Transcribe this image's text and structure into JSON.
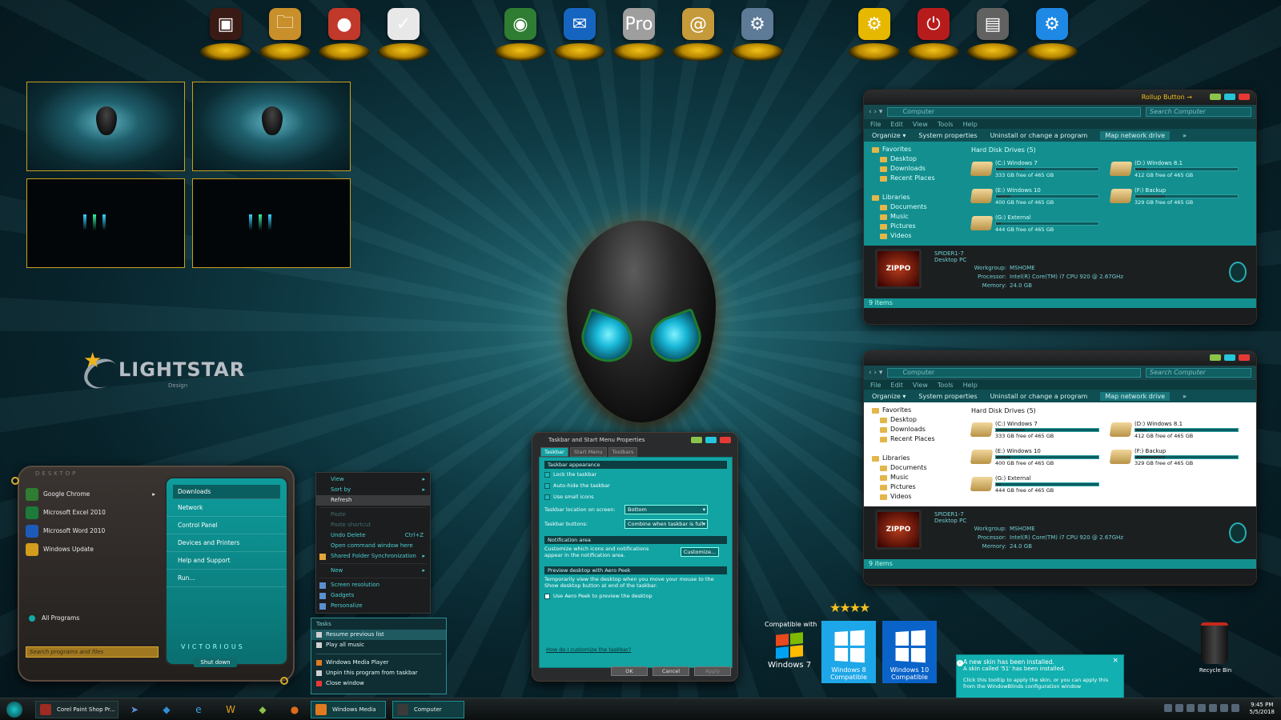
{
  "dock": {
    "left": [
      {
        "name": "zippo-icon",
        "color": "#3a1a14",
        "glyph": "▣"
      },
      {
        "name": "folder-icon",
        "color": "#c98f2a",
        "glyph": "🗀"
      },
      {
        "name": "zippo-ball-icon",
        "color": "#c0392b",
        "glyph": "●"
      },
      {
        "name": "calendar-check-icon",
        "color": "#e8e8e8",
        "glyph": "✓"
      }
    ],
    "middle": [
      {
        "name": "chrome-icon",
        "color": "#2e7d32",
        "glyph": "◉"
      },
      {
        "name": "thunderbird-icon",
        "color": "#1565c0",
        "glyph": "✉"
      },
      {
        "name": "pro-ball-icon",
        "color": "#9e9e9e",
        "glyph": "Pro"
      },
      {
        "name": "address-book-icon",
        "color": "#c49a3a",
        "glyph": "@"
      },
      {
        "name": "control-panel-icon",
        "color": "#5d7a96",
        "glyph": "⚙"
      }
    ],
    "right": [
      {
        "name": "settings-folder-icon",
        "color": "#e6b800",
        "glyph": "⚙"
      },
      {
        "name": "power-gear-icon",
        "color": "#b71c1c",
        "glyph": "⏻"
      },
      {
        "name": "server-icon",
        "color": "#616161",
        "glyph": "▤"
      },
      {
        "name": "gear-molecule-icon",
        "color": "#1e88e5",
        "glyph": "⚙"
      }
    ]
  },
  "lightstar": {
    "word": "LIGHTSTAR",
    "sub": "Design"
  },
  "explorer1": {
    "rollup": "Rollup Button →",
    "path": "Computer",
    "search": "Search Computer",
    "menu": [
      "File",
      "Edit",
      "View",
      "Tools",
      "Help"
    ],
    "cmd": {
      "organize": "Organize ▾",
      "system": "System properties",
      "uninstall": "Uninstall or change a program",
      "map": "Map network drive",
      "more": "»"
    },
    "nav": [
      {
        "label": "Favorites",
        "child": false
      },
      {
        "label": "Desktop",
        "child": true
      },
      {
        "label": "Downloads",
        "child": true
      },
      {
        "label": "Recent Places",
        "child": true
      },
      {
        "label": "",
        "child": false
      },
      {
        "label": "Libraries",
        "child": false
      },
      {
        "label": "Documents",
        "child": true
      },
      {
        "label": "Music",
        "child": true
      },
      {
        "label": "Pictures",
        "child": true
      },
      {
        "label": "Videos",
        "child": true
      }
    ],
    "group": "Hard Disk Drives (5)",
    "drives": [
      {
        "name": "(C:) Windows 7",
        "free": "333 GB free of 465 GB",
        "used": 0.28
      },
      {
        "name": "(D:) Windows 8.1",
        "free": "412 GB free of 465 GB",
        "used": 0.11
      },
      {
        "name": "(E:) Windows 10",
        "free": "400 GB free of 465 GB",
        "used": 0.14
      },
      {
        "name": "(F:) Backup",
        "free": "329 GB free of 465 GB",
        "used": 0.29
      },
      {
        "name": "(G:) External",
        "free": "444 GB free of 465 GB",
        "used": 0.05
      }
    ],
    "details": {
      "pc_label": "ZIPPO",
      "name": "SPIDER1-7",
      "type": "Desktop PC",
      "rows": [
        {
          "k": "Workgroup:",
          "v": "MSHOME"
        },
        {
          "k": "Processor:",
          "v": "Intel(R) Core(TM) i7 CPU       920  @ 2.67GHz"
        },
        {
          "k": "Memory:",
          "v": "24.0 GB"
        }
      ]
    },
    "status": "9 items"
  },
  "explorer2": {
    "path": "Computer",
    "search": "Search Computer",
    "menu": [
      "File",
      "Edit",
      "View",
      "Tools",
      "Help"
    ],
    "cmd": {
      "organize": "Organize ▾",
      "system": "System properties",
      "uninstall": "Uninstall or change a program",
      "map": "Map network drive",
      "more": "»"
    },
    "nav": [
      {
        "label": "Favorites",
        "child": false
      },
      {
        "label": "Desktop",
        "child": true
      },
      {
        "label": "Downloads",
        "child": true
      },
      {
        "label": "Recent Places",
        "child": true
      },
      {
        "label": "",
        "child": false
      },
      {
        "label": "Libraries",
        "child": false
      },
      {
        "label": "Documents",
        "child": true
      },
      {
        "label": "Music",
        "child": true
      },
      {
        "label": "Pictures",
        "child": true
      },
      {
        "label": "Videos",
        "child": true
      }
    ],
    "group": "Hard Disk Drives (5)",
    "drives": [
      {
        "name": "(C:) Windows 7",
        "free": "333 GB free of 465 GB",
        "used": 0.28
      },
      {
        "name": "(D:) Windows 8.1",
        "free": "412 GB free of 465 GB",
        "used": 0.11
      },
      {
        "name": "(E:) Windows 10",
        "free": "400 GB free of 465 GB",
        "used": 0.14
      },
      {
        "name": "(F:) Backup",
        "free": "329 GB free of 465 GB",
        "used": 0.29
      },
      {
        "name": "(G:) External",
        "free": "444 GB free of 465 GB",
        "used": 0.05
      }
    ],
    "details": {
      "pc_label": "ZIPPO",
      "name": "SPIDER1-7",
      "type": "Desktop PC",
      "rows": [
        {
          "k": "Workgroup:",
          "v": "MSHOME"
        },
        {
          "k": "Processor:",
          "v": "Intel(R) Core(TM) i7 CPU       920  @ 2.67GHz"
        },
        {
          "k": "Memory:",
          "v": "24.0 GB"
        }
      ]
    },
    "status": "9 items"
  },
  "start": {
    "topbar": "DESKTOP",
    "apps": [
      {
        "label": "Google Chrome",
        "color": "#2e7d32",
        "arrow": "▸"
      },
      {
        "label": "Microsoft Excel 2010",
        "color": "#1d7a3a",
        "arrow": ""
      },
      {
        "label": "Microsoft Word 2010",
        "color": "#1e5bb8",
        "arrow": ""
      },
      {
        "label": "Windows Update",
        "color": "#d39c1d",
        "arrow": ""
      }
    ],
    "all_programs": "All Programs",
    "search": "Search programs and files",
    "right": [
      "Downloads",
      "Network",
      "Control Panel",
      "Devices and Printers",
      "Help and Support",
      "Run..."
    ],
    "signature": "VICTORIOUS",
    "shutdown": "Shut down"
  },
  "context_menu": [
    {
      "label": "View",
      "arrow": "▸",
      "state": ""
    },
    {
      "label": "Sort by",
      "arrow": "▸",
      "state": ""
    },
    {
      "label": "Refresh",
      "arrow": "",
      "state": "hl"
    },
    {
      "sep": true
    },
    {
      "label": "Paste",
      "arrow": "",
      "state": "dis"
    },
    {
      "label": "Paste shortcut",
      "arrow": "",
      "state": "dis"
    },
    {
      "label": "Undo Delete",
      "shortcut": "Ctrl+Z",
      "state": ""
    },
    {
      "label": "Open command window here",
      "state": ""
    },
    {
      "label": "Shared Folder Synchronization",
      "arrow": "▸",
      "state": "",
      "icon": "#e3a53a"
    },
    {
      "sep": true
    },
    {
      "label": "New",
      "arrow": "▸",
      "state": ""
    },
    {
      "sep": true
    },
    {
      "label": "Screen resolution",
      "state": "",
      "icon": "#5a8fd0"
    },
    {
      "label": "Gadgets",
      "state": "",
      "icon": "#5a8fd0"
    },
    {
      "label": "Personalize",
      "state": "",
      "icon": "#5a8fd0"
    }
  ],
  "jumplist": {
    "header": "Tasks",
    "tasks": [
      "Resume previous list",
      "Play all music"
    ],
    "pinned": [
      "Windows Media Player",
      "Unpin this program from taskbar",
      "Close window"
    ]
  },
  "props": {
    "title": "Taskbar and Start Menu Properties",
    "tabs": [
      "Taskbar",
      "Start Menu",
      "Toolbars"
    ],
    "appearance": "Taskbar appearance",
    "checks": [
      {
        "label": "Lock the taskbar",
        "on": false
      },
      {
        "label": "Auto-hide the taskbar",
        "on": false
      },
      {
        "label": "Use small icons",
        "on": false
      }
    ],
    "location_label": "Taskbar location on screen:",
    "location_value": "Bottom",
    "buttons_label": "Taskbar buttons:",
    "buttons_value": "Combine when taskbar is full",
    "notif": "Notification area",
    "notif_text": "Customize which icons and notifications appear in the notification area.",
    "customize": "Customize...",
    "peek": "Preview desktop with Aero Peek",
    "peek_text": "Temporarily view the desktop when you move your mouse to the Show desktop button at end of the taskbar.",
    "peek_check": "Use Aero Peek to preview the desktop",
    "howto": "How do I customize the taskbar?",
    "ok": "OK",
    "cancel": "Cancel",
    "apply": "Apply"
  },
  "compat": {
    "label": "Compatible with",
    "win7": "Windows 7",
    "win8": {
      "name": "Windows 8",
      "comp": "Compatible",
      "bg": "#1ea7e8"
    },
    "win10": {
      "name": "Windows 10",
      "comp": "Compatible",
      "bg": "#0a63c9"
    },
    "stars": "★★★★"
  },
  "toast": {
    "title": "A new skin has been installed.",
    "sub": "A skin called '51' has been installed.",
    "body": "Click this tooltip to apply the skin, or you can apply this from the WindowBlinds configuration window"
  },
  "recycle": "Recycle Bin",
  "taskbar": {
    "buttons": [
      {
        "label": "Corel Paint Shop Pr...",
        "color": "#9c2b22",
        "active": false
      },
      {
        "label": "Windows Media Pl...",
        "color": "#e07a20",
        "active": true
      },
      {
        "label": "Computer",
        "color": "#3a3a3a",
        "active": true
      }
    ],
    "icons": [
      {
        "name": "cursor-icon",
        "glyph": "➤",
        "color": "#5b8fd8"
      },
      {
        "name": "cube-icon",
        "glyph": "◆",
        "color": "#2f8fd8"
      },
      {
        "name": "internet-explorer-icon",
        "glyph": "e",
        "color": "#3aa0e0"
      },
      {
        "name": "wings-icon",
        "glyph": "W",
        "color": "#e0a020"
      },
      {
        "name": "gem-icon",
        "glyph": "◆",
        "color": "#8bc34a"
      },
      {
        "name": "firefox-icon",
        "glyph": "●",
        "color": "#e06a1a"
      }
    ],
    "time": "9:45 PM",
    "date": "5/5/2018"
  }
}
